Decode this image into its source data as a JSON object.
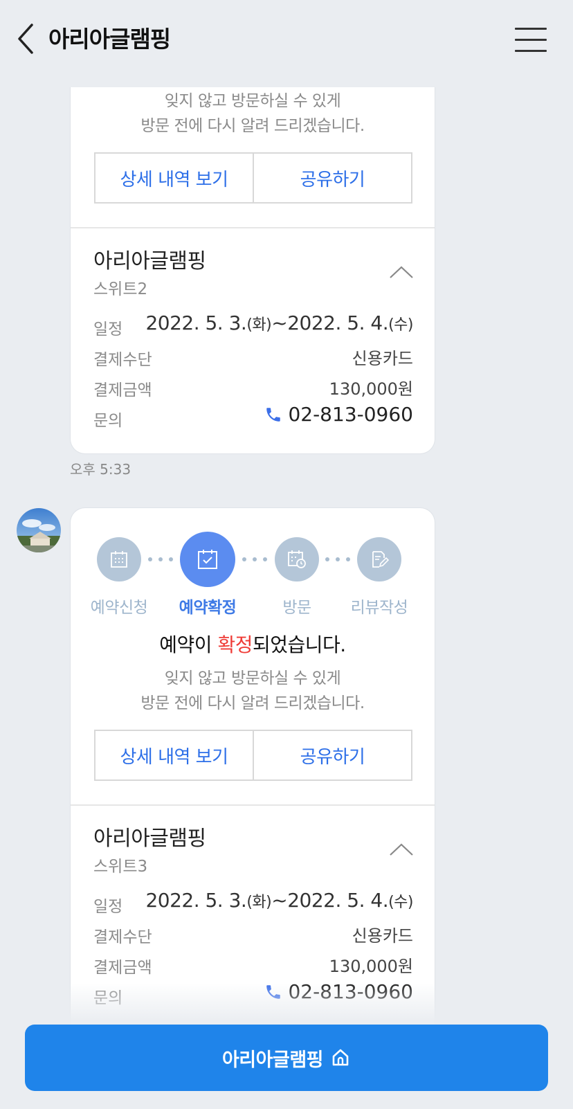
{
  "header": {
    "title": "아리아글램핑"
  },
  "cards": [
    {
      "notice_line1": "잊지 않고 방문하실 수 있게",
      "notice_line2": "방문 전에 다시 알려 드리겠습니다.",
      "detail_button": "상세 내역 보기",
      "share_button": "공유하기",
      "shop_name": "아리아글램핑",
      "room_name": "스위트2",
      "schedule_label": "일정",
      "schedule_start": "2022. 5. 3.",
      "schedule_start_day": "(화)",
      "schedule_sep": "~",
      "schedule_end": "2022. 5. 4.",
      "schedule_end_day": "(수)",
      "payment_label": "결제수단",
      "payment_value": "신용카드",
      "amount_label": "결제금액",
      "amount_value": "130,000원",
      "inquiry_label": "문의",
      "phone": "02-813-0960"
    },
    {
      "steps": [
        "예약신청",
        "예약확정",
        "방문",
        "리뷰작성"
      ],
      "active_step": 1,
      "confirm_prefix": "예약이 ",
      "confirm_highlight": "확정",
      "confirm_suffix": "되었습니다.",
      "notice_line1": "잊지 않고 방문하실 수 있게",
      "notice_line2": "방문 전에 다시 알려 드리겠습니다.",
      "detail_button": "상세 내역 보기",
      "share_button": "공유하기",
      "shop_name": "아리아글램핑",
      "room_name": "스위트3",
      "schedule_label": "일정",
      "schedule_start": "2022. 5. 3.",
      "schedule_start_day": "(화)",
      "schedule_sep": "~",
      "schedule_end": "2022. 5. 4.",
      "schedule_end_day": "(수)",
      "payment_label": "결제수단",
      "payment_value": "신용카드",
      "amount_label": "결제금액",
      "amount_value": "130,000원",
      "inquiry_label": "문의",
      "phone": "02-813-0960"
    }
  ],
  "timestamp": "오후 5:33",
  "bottom_button": {
    "label": "아리아글램핑"
  },
  "colors": {
    "accent": "#1f84ea",
    "link": "#2d6fe8",
    "highlight": "#ef3b36",
    "step_active": "#5b8cf0",
    "step_inactive": "#b4c6d8"
  },
  "icons": [
    "back-icon",
    "menu-icon",
    "chevron-up-icon",
    "phone-icon",
    "calendar-icon",
    "calendar-check-icon",
    "calendar-clock-icon",
    "edit-document-icon",
    "home-icon"
  ]
}
